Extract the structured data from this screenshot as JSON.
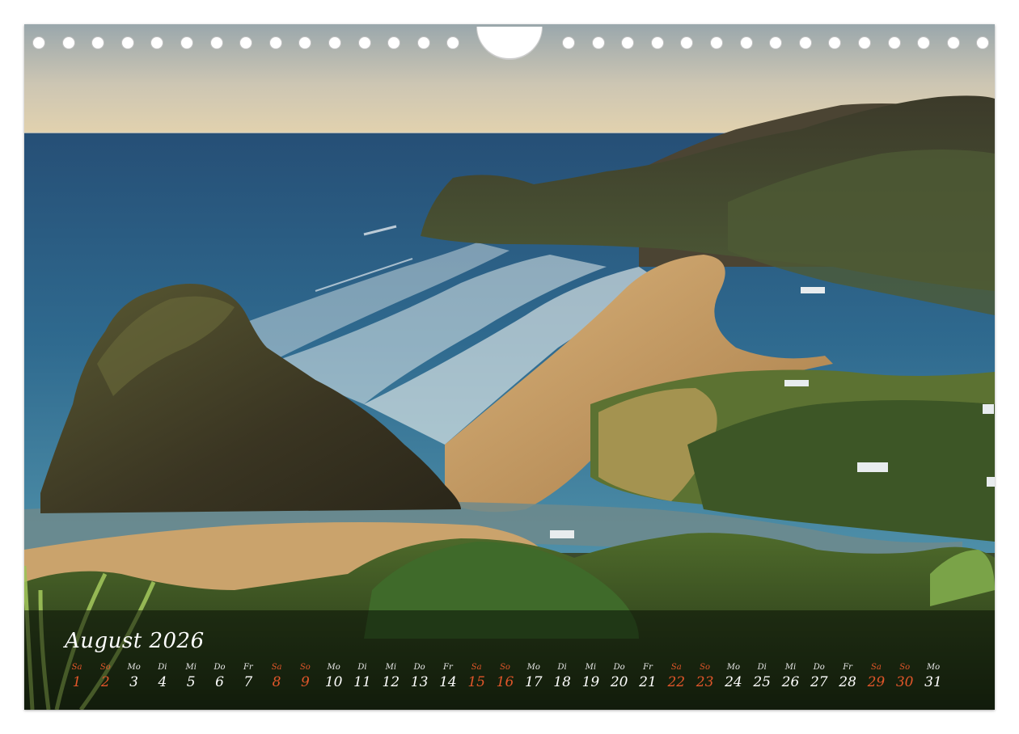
{
  "calendar": {
    "month_title": "August 2026",
    "days": [
      {
        "wd": "Sa",
        "num": "1",
        "weekend": true
      },
      {
        "wd": "So",
        "num": "2",
        "weekend": true
      },
      {
        "wd": "Mo",
        "num": "3",
        "weekend": false
      },
      {
        "wd": "Di",
        "num": "4",
        "weekend": false
      },
      {
        "wd": "Mi",
        "num": "5",
        "weekend": false
      },
      {
        "wd": "Do",
        "num": "6",
        "weekend": false
      },
      {
        "wd": "Fr",
        "num": "7",
        "weekend": false
      },
      {
        "wd": "Sa",
        "num": "8",
        "weekend": true
      },
      {
        "wd": "So",
        "num": "9",
        "weekend": true
      },
      {
        "wd": "Mo",
        "num": "10",
        "weekend": false
      },
      {
        "wd": "Di",
        "num": "11",
        "weekend": false
      },
      {
        "wd": "Mi",
        "num": "12",
        "weekend": false
      },
      {
        "wd": "Do",
        "num": "13",
        "weekend": false
      },
      {
        "wd": "Fr",
        "num": "14",
        "weekend": false
      },
      {
        "wd": "Sa",
        "num": "15",
        "weekend": true
      },
      {
        "wd": "So",
        "num": "16",
        "weekend": true
      },
      {
        "wd": "Mo",
        "num": "17",
        "weekend": false
      },
      {
        "wd": "Di",
        "num": "18",
        "weekend": false
      },
      {
        "wd": "Mi",
        "num": "19",
        "weekend": false
      },
      {
        "wd": "Do",
        "num": "20",
        "weekend": false
      },
      {
        "wd": "Fr",
        "num": "21",
        "weekend": false
      },
      {
        "wd": "Sa",
        "num": "22",
        "weekend": true
      },
      {
        "wd": "So",
        "num": "23",
        "weekend": true
      },
      {
        "wd": "Mo",
        "num": "24",
        "weekend": false
      },
      {
        "wd": "Di",
        "num": "25",
        "weekend": false
      },
      {
        "wd": "Mi",
        "num": "26",
        "weekend": false
      },
      {
        "wd": "Do",
        "num": "27",
        "weekend": false
      },
      {
        "wd": "Fr",
        "num": "28",
        "weekend": false
      },
      {
        "wd": "Sa",
        "num": "29",
        "weekend": true
      },
      {
        "wd": "So",
        "num": "30",
        "weekend": true
      },
      {
        "wd": "Mo",
        "num": "31",
        "weekend": false
      }
    ]
  },
  "colors": {
    "weekend": "#e0562a",
    "weekday": "#ffffff",
    "sky": "#c9c4b4",
    "ocean": "#2c5f86",
    "sand": "#c99e62",
    "hills": "#2b3a24"
  },
  "photo": {
    "subject": "coastal-landscape"
  }
}
